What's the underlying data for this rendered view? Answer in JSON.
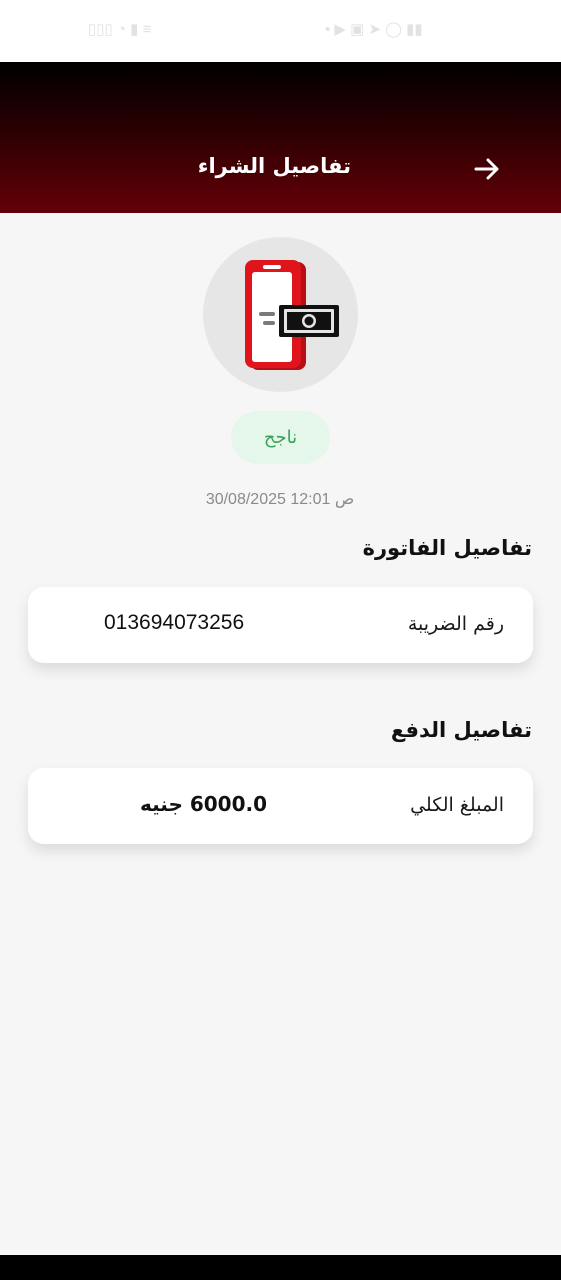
{
  "header": {
    "title": "تفاصيل الشراء"
  },
  "status": {
    "label": "ناجح",
    "color": "#3aa15a"
  },
  "transaction": {
    "datetime": "30/08/2025 12:01 ص"
  },
  "invoice_section": {
    "title": "تفاصيل الفاتورة",
    "tax_number_label": "رقم الضريبة",
    "tax_number_value": "013694073256"
  },
  "payment_section": {
    "title": "تفاصيل الدفع",
    "total_label": "المبلغ الكلي",
    "total_value": "6000.0 جنيه"
  },
  "colors": {
    "header_gradient_top": "#000000",
    "header_gradient_bottom": "#640007",
    "phone_red": "#e0141b",
    "background": "#f6f6f6"
  },
  "icons": {
    "back": "arrow-right-icon",
    "illustration": "phone-payment-icon"
  }
}
